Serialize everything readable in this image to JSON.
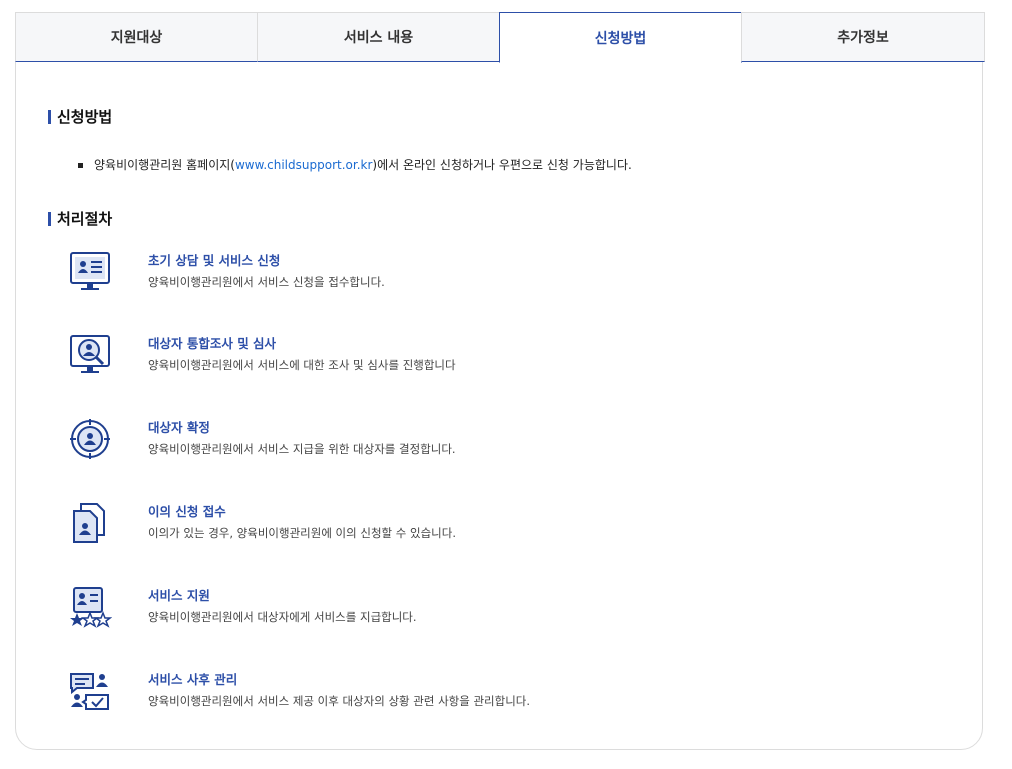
{
  "tabs": [
    {
      "label": "지원대상"
    },
    {
      "label": "서비스 내용"
    },
    {
      "label": "신청방법"
    },
    {
      "label": "추가정보"
    }
  ],
  "apply": {
    "heading": "신청방법",
    "text_before": "양육비이행관리원 홈페이지(",
    "link": "www.childsupport.or.kr",
    "text_after": ")에서 온라인 신청하거나 우편으로 신청 가능합니다."
  },
  "process": {
    "heading": "처리절차",
    "steps": [
      {
        "icon": "monitor-profile-icon",
        "title": "초기 상담 및 서비스 신청",
        "desc": "양육비이행관리원에서 서비스 신청을 접수합니다."
      },
      {
        "icon": "monitor-search-icon",
        "title": "대상자 통합조사 및 심사",
        "desc": "양육비이행관리원에서 서비스에 대한 조사 및 심사를 진행합니다"
      },
      {
        "icon": "target-user-icon",
        "title": "대상자 확정",
        "desc": "양육비이행관리원에서 서비스 지급을 위한 대상자를 결정합니다."
      },
      {
        "icon": "documents-user-icon",
        "title": "이의 신청 접수",
        "desc": "이의가 있는 경우, 양육비이행관리원에 이의 신청할 수 있습니다."
      },
      {
        "icon": "profile-stars-icon",
        "title": "서비스 지원",
        "desc": "양육비이행관리원에서 대상자에게 서비스를 지급합니다."
      },
      {
        "icon": "chat-check-icon",
        "title": "서비스 사후 관리",
        "desc": "양육비이행관리원에서 서비스 제공 이후 대상자의 상황 관련 사항을 관리합니다."
      }
    ]
  },
  "colors": {
    "accent": "#2d4fa8",
    "link": "#1b6bd1"
  }
}
